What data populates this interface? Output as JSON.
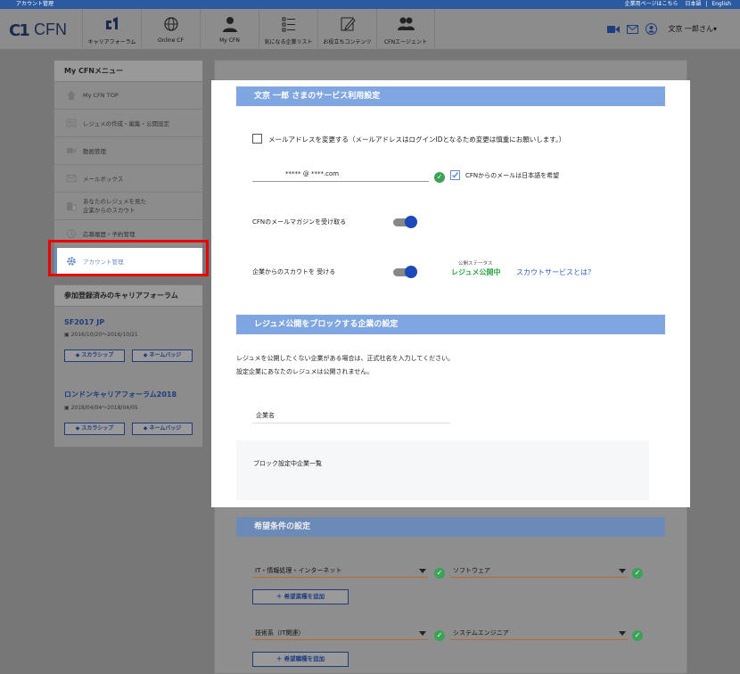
{
  "topbar": {
    "left_text": "アカウント管理",
    "corporate_link": "企業用ページはこちら",
    "lang_ja": "日本語",
    "lang_sep": "|",
    "lang_en": "English"
  },
  "header": {
    "logo_mark": "C1",
    "logo_text": "CFN",
    "nav": [
      {
        "label": "キャリアフォーラム",
        "icon": "cf-logo-icon"
      },
      {
        "label": "Online CF",
        "icon": "globe-icon"
      },
      {
        "label": "My CFN",
        "icon": "person-icon"
      },
      {
        "label": "気になる企業リスト",
        "icon": "list-icon"
      },
      {
        "label": "お役立ちコンテンツ",
        "icon": "pencil-icon"
      },
      {
        "label": "CFNエージェント",
        "icon": "people-icon"
      }
    ],
    "user_name": "文京 一郎さん▾"
  },
  "sidebar": {
    "title": "My CFNメニュー",
    "items": [
      {
        "label": "My CFN TOP",
        "icon": "home-icon"
      },
      {
        "label": "レジュメの作成・編集・公開設定",
        "icon": "resume-icon"
      },
      {
        "label": "動画管理",
        "icon": "video-icon"
      },
      {
        "label": "メールボックス",
        "icon": "mail-icon"
      },
      {
        "label": "あなたのレジュメを見た",
        "label2": "企業からのスカウト",
        "icon": "building-icon"
      },
      {
        "label": "応募履歴・予約管理",
        "icon": "history-icon"
      },
      {
        "label": "アカウント管理",
        "icon": "gear-icon"
      }
    ]
  },
  "forums": {
    "title": "参加登録済みのキャリアフォーラム",
    "list": [
      {
        "name": "SF2017 JP",
        "date": "2016/10/20〜2016/10/21",
        "btn1": "スカラシップ",
        "btn2": "ネームバッジ"
      },
      {
        "name": "ロンドンキャリアフォーラム2018",
        "date": "2018/04/04〜2018/04/05",
        "btn1": "スカラシップ",
        "btn2": "ネームバッジ"
      }
    ]
  },
  "service": {
    "title": "文京 一郎 さまのサービス利用設定",
    "change_email_label": "メールアドレスを変更する（メールアドレスはログインIDとなるため変更は慎重にお願いします。）",
    "email_value": "***** @ ****.com",
    "japanese_mail_label": "CFNからのメールは日本語を希望",
    "magazine_label": "CFNのメールマガジンを受け取る",
    "scout_label": "企業からのスカウトを 受ける",
    "public_status_caption": "公開ステータス",
    "public_status_value": "レジュメ公開中",
    "scout_service_link": "スカウトサービスとは？"
  },
  "block": {
    "title": "レジュメ公開をブロックする企業の設定",
    "desc1": "レジュメを公開したくない企業がある場合は、正式社名を入力してください。",
    "desc2": "設定企業にあなたのレジュメは公開されません。",
    "company_placeholder": "企業名",
    "blocked_list_title": "ブロック設定中企業一覧"
  },
  "preferences": {
    "title": "希望条件の設定",
    "industry_1": "IT・情報処理・インターネット",
    "industry_2": "ソフトウェア",
    "add_industry": "＋ 希望業種を追加",
    "job_1": "技術系（IT関連）",
    "job_2": "システムエンジニア",
    "add_job": "＋ 希望職種を追加"
  },
  "colors": {
    "accent_blue": "#7fa6e0",
    "link_blue": "#2b60c9",
    "status_green": "#2ea84a",
    "highlight_red": "#e00000"
  }
}
